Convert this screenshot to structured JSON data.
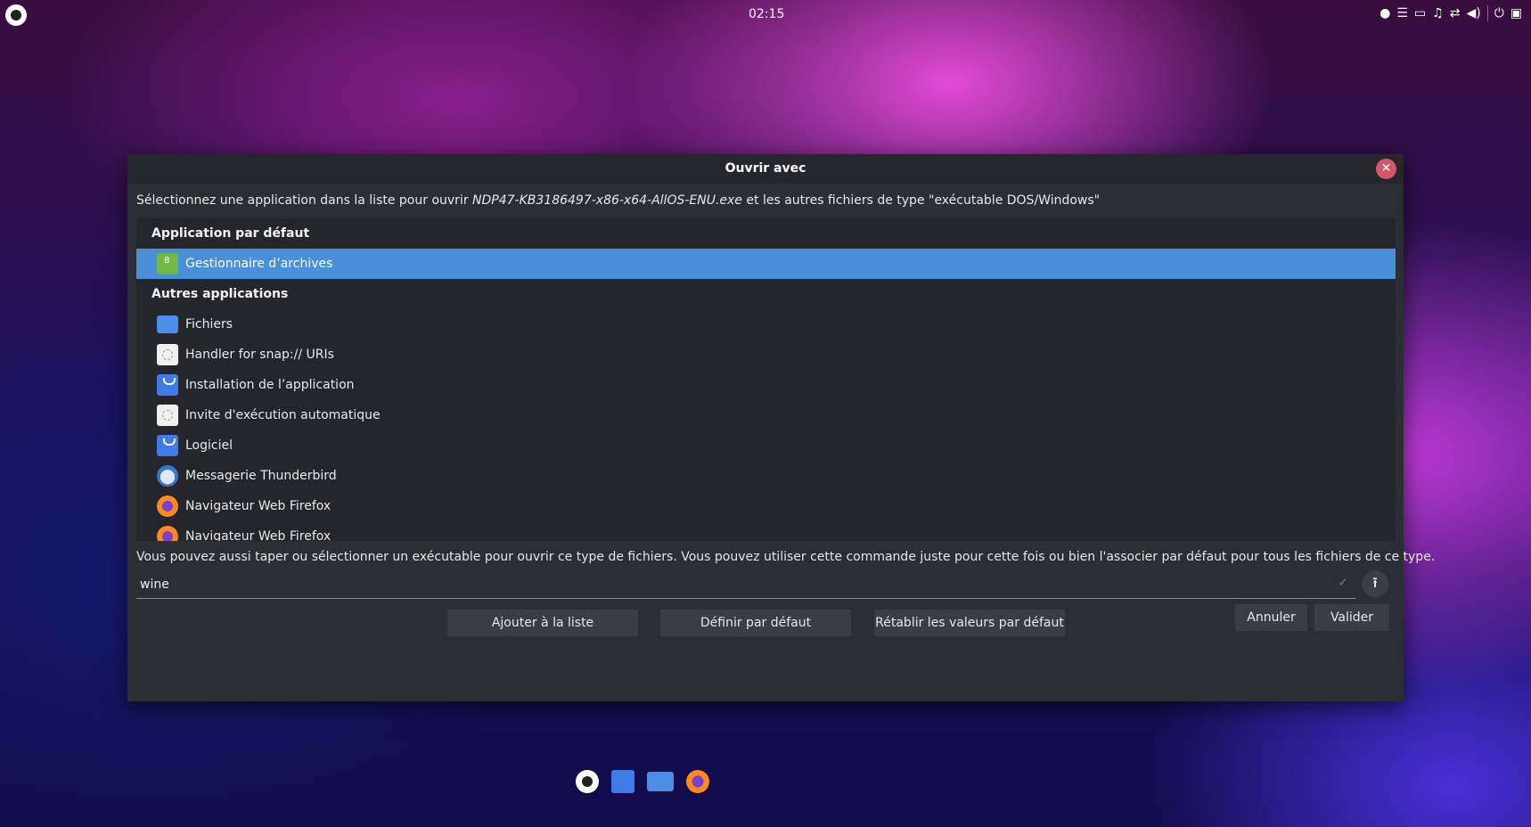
{
  "topbar": {
    "clock": "02:15",
    "tray_icons": [
      "dot-icon",
      "menu-icon",
      "folder-icon",
      "bell-icon",
      "network-icon",
      "volume-icon",
      "power-icon",
      "keyboard-icon"
    ]
  },
  "dialog": {
    "title": "Ouvrir avec",
    "close_glyph": "✕",
    "intro_prefix": "Sélectionnez une application dans la liste pour ouvrir ",
    "intro_file": "NDP47-KB3186497-x86-x64-AllOS-ENU.exe",
    "intro_suffix": " et les autres fichiers de type \"exécutable DOS/Windows\"",
    "default_section": "Application par défaut",
    "default_app": "Gestionnaire d’archives",
    "other_section": "Autres applications",
    "other_apps": [
      "Fichiers",
      "Handler for snap:// URIs",
      "Installation de l’application",
      "Invite d'exécution automatique",
      "Logiciel",
      "Messagerie Thunderbird",
      "Navigateur Web Firefox",
      "Navigateur Web Firefox"
    ],
    "hint": "Vous pouvez aussi taper ou sélectionner un exécutable pour ouvrir ce type de fichiers. Vous pouvez utiliser cette commande juste pour cette fois ou bien l'associer par défaut pour tous les fichiers de ce type.",
    "command_value": "wine",
    "browse_glyph": "⭱",
    "check_glyph": "✓",
    "buttons": {
      "add": "Ajouter à la liste",
      "set_default": "Définir par défaut",
      "reset": "Rétablir les valeurs par défaut",
      "cancel": "Annuler",
      "ok": "Valider"
    }
  },
  "colors": {
    "selection": "#4a90d9",
    "dialog_bg": "#2c2e35",
    "close_button": "#d6576a"
  }
}
